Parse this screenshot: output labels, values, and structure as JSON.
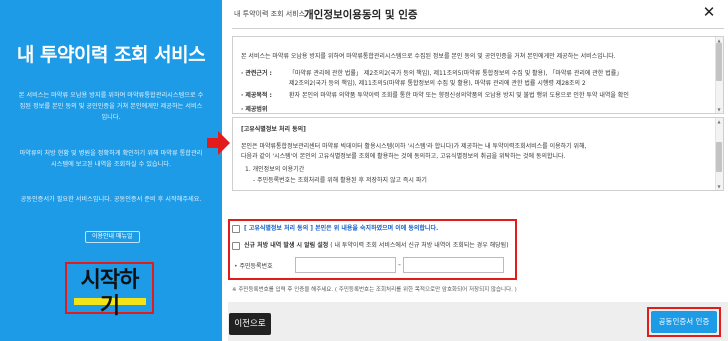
{
  "left_panel": {
    "title": "내 투약이력 조회 서비스",
    "para1_line1": "본 서비스는 마약류 오남용 방지를 위하여 마약류통합관리시스템으로 수",
    "para1_line2": "집된 정보를 본인 동의 및 공인인증을 거쳐 본인에게만 제공하는 서비스",
    "para1_line3": "입니다.",
    "para2_line1": "마약류의 처방 현황 및 병원을 정확하게 확인하기 위해 마약류 통합관리",
    "para2_line2": "시스템에 보고된 내역을 조회하실 수 있습니다.",
    "para3": "공동인증서가 필요한 서비스입니다. 공동인증서 준비 후 시작해주세요.",
    "manual_label": "이용안내 매뉴얼",
    "start_label": "시작하기"
  },
  "header": {
    "breadcrumb": "내 투약이력 조회 서비스",
    "title": "개인정보이용동의 및 인증",
    "close_symbol": "✕"
  },
  "service_box": {
    "intro": "본 서비스는 마약류 오남용 방지를 위하여 마약류통합관리시스템으로 수집된 정보를 본인 동의 및 공인인증을 거쳐 본인에게만 제공하는 서비스입니다.",
    "law_label": "· 관련근거 :",
    "law_line1": "「마약류 관리에 관한 법률」 제2조의2(국가 등의 책임), 제11조의5(마약류 통합정보의 수집 및 활용), 「마약류 관리에 관한 법률」",
    "law_line2": "제2조의2(국가 등의 책임), 제11조의5(마약류 통합정보의 수집 및 활용), 마약류 관리에 관한 법률 시행령 제28조의 2",
    "purpose_label": "· 제공목적 :",
    "purpose": "환자 본인의 마약류 의약품 투약이력 조회를 통한 마약 또는 향정신성의약품의 오남용 방지 및 불법 행위 도용으로 인한 투약 내역을 확인",
    "scope_label": "· 제공범위"
  },
  "unique_box": {
    "heading": "[고유식별정보 처리 동의]",
    "line1": "본인은 마약류통합정보관리센터 마약류 빅데이터 활용시스템(이하 '시스템'라 합니다)가 제공하는 내 투약이력조회서비스를 이용하기 위해,",
    "line2": "다음과 같이 '시스템'이 본인의 고유식별정보를 조회에 활용하는 것에 동의하고, 고유식별정보의 취급을 위탁하는 것에 동의합니다.",
    "line3": "1. 개인정보의 이용기간",
    "line4": "- 주민등록번호는 조회처리를 위해 활용된 후 저장하지 않고 즉시 파기"
  },
  "consent": {
    "agree_label": "[ 고유식별정보 처리 동의 ] 본인은 위 내용을 숙지하였으며 이에 동의합니다.",
    "alarm_label_bold": "신규 처방 내역 발생 시 알림 설정",
    "alarm_label_rest": "( 내 투약이력 조회 서비스에서 신규 처방 내역이 조회되는 경우 해당됨)",
    "id_label": "주민등록번호",
    "id_dot": "•",
    "id_dash": "-"
  },
  "note": "※ 주민등록번호를 입력 후 인증을 해주세요. ( 주민등록번호는 조회처리를 위한 목적으로만 암호화되어 저장되지 않습니다. )",
  "buttons": {
    "prev": "이전으로",
    "cert": "공동인증서 인증"
  },
  "colors": {
    "brand_blue": "#1e9be6",
    "highlight_red": "#e21b1b",
    "highlight_yellow": "#f3e41a",
    "consent_blue": "#1561c9"
  }
}
